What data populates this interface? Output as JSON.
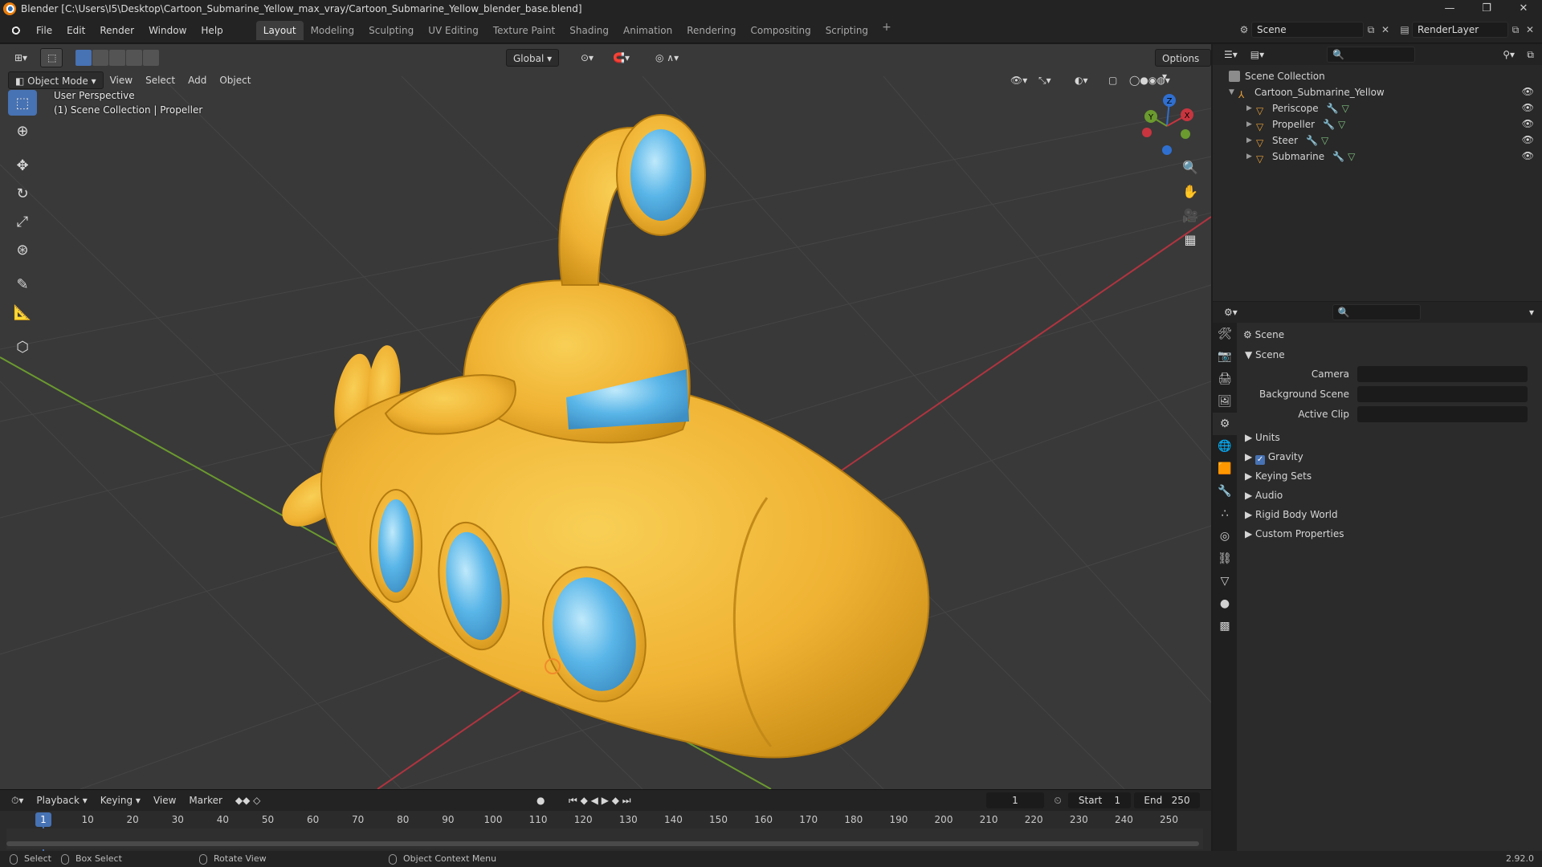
{
  "window": {
    "title": "Blender [C:\\Users\\I5\\Desktop\\Cartoon_Submarine_Yellow_max_vray/Cartoon_Submarine_Yellow_blender_base.blend]",
    "controls": [
      "—",
      "❐",
      "✕"
    ]
  },
  "menus": [
    "File",
    "Edit",
    "Render",
    "Window",
    "Help"
  ],
  "workspaces": {
    "tabs": [
      "Layout",
      "Modeling",
      "Sculpting",
      "UV Editing",
      "Texture Paint",
      "Shading",
      "Animation",
      "Rendering",
      "Compositing",
      "Scripting"
    ],
    "active": "Layout",
    "add": "+"
  },
  "scene": {
    "name": "Scene",
    "render_layer": "RenderLayer"
  },
  "viewport": {
    "mode": "Object Mode",
    "menus": [
      "View",
      "Select",
      "Add",
      "Object"
    ],
    "orientation": "Global",
    "options_label": "Options",
    "info_line1": "User Perspective",
    "info_line2": "(1) Scene Collection | Propeller",
    "gizmo_axes": {
      "x": "X",
      "y": "Y",
      "z": "Z"
    },
    "colors": {
      "background": "#393939",
      "grid": "#4a4a4a",
      "x_axis": "#b0343f",
      "y_axis": "#6b9a2f",
      "hull": "#f2b83a",
      "window": "#5ab6e8"
    }
  },
  "tools": [
    "select-box-icon",
    "cursor-icon",
    "move-icon",
    "rotate-icon",
    "scale-icon",
    "transform-icon",
    "annotate-icon",
    "measure-icon",
    "add-cube-icon"
  ],
  "timeline": {
    "menus": [
      "Playback",
      "Keying",
      "View",
      "Marker"
    ],
    "current_frame": "1",
    "start_label": "Start",
    "start": "1",
    "end_label": "End",
    "end": "250",
    "ruler": [
      "1",
      "10",
      "20",
      "30",
      "40",
      "50",
      "60",
      "70",
      "80",
      "90",
      "100",
      "110",
      "120",
      "130",
      "140",
      "150",
      "160",
      "170",
      "180",
      "190",
      "200",
      "210",
      "220",
      "230",
      "240",
      "250"
    ]
  },
  "outliner": {
    "root": "Scene Collection",
    "collection": "Cartoon_Submarine_Yellow",
    "objects": [
      "Periscope",
      "Propeller",
      "Steer",
      "Submarine"
    ]
  },
  "properties": {
    "context": "Scene",
    "panel_title": "Scene",
    "fields": [
      {
        "label": "Camera",
        "value": ""
      },
      {
        "label": "Background Scene",
        "value": ""
      },
      {
        "label": "Active Clip",
        "value": ""
      }
    ],
    "subpanels": [
      "Units",
      "Gravity",
      "Keying Sets",
      "Audio",
      "Rigid Body World",
      "Custom Properties"
    ],
    "gravity_checked": true
  },
  "statusbar": {
    "select": "Select",
    "box_select": "Box Select",
    "rotate_view": "Rotate View",
    "context_menu": "Object Context Menu",
    "version": "2.92.0"
  }
}
